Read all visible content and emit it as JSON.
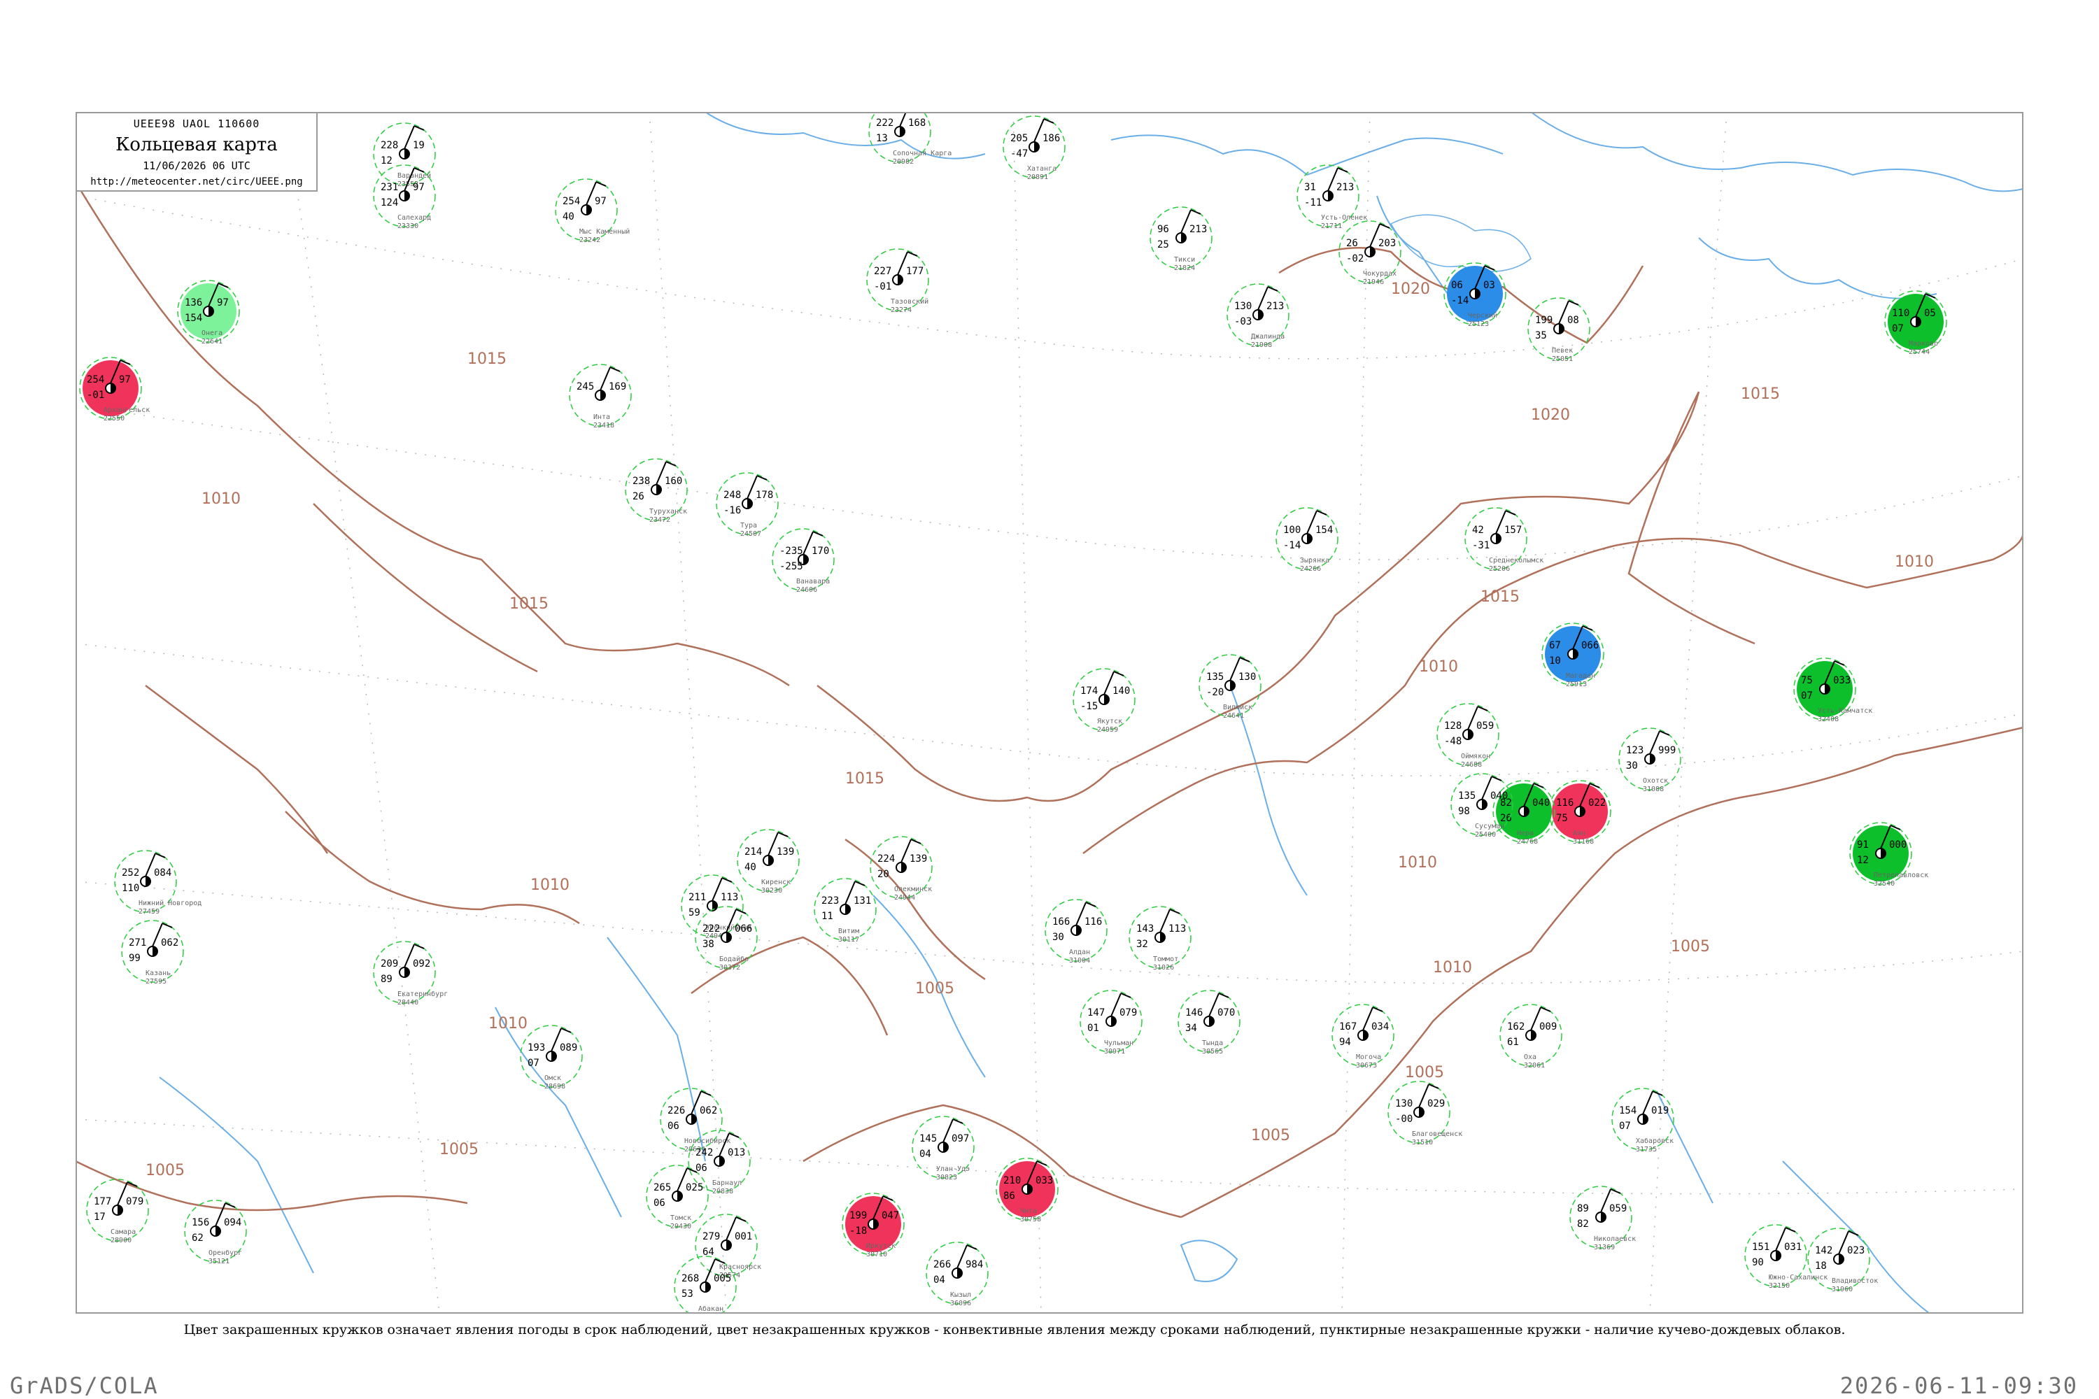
{
  "header": {
    "code_line": "UEEE98  UAOL  110600",
    "title": "Кольцевая карта",
    "datetime": "11/06/2026 06 UTC",
    "url": "http://meteocenter.net/circ/UEEE.png"
  },
  "caption": "Цвет закрашенных кружков означает явления погоды в срок наблюдений, цвет незакрашенных кружков - конвективные явления между сроками наблюдений, пунктирные незакрашенные кружки - наличие кучево-дождевых облаков.",
  "footer": {
    "left": "GrADS/COLA",
    "right": "2026-06-11-09:30"
  },
  "colors": {
    "isobar": "#b0705a",
    "water": "#6aaee8",
    "border": "#9a9a9a",
    "rain": "#0dbf2b",
    "thunder": "#f0335a",
    "snow": "#2b8de8",
    "drizzle": "#7ef29a",
    "cb_dashed": "#2ecc40"
  },
  "isobar_labels": [
    "1020",
    "1020",
    "1015",
    "1015",
    "1015",
    "1015",
    "1015",
    "1010",
    "1010",
    "1010",
    "1010",
    "1010",
    "1010",
    "1010",
    "1005",
    "1005",
    "1005",
    "1005",
    "1005",
    "1005"
  ],
  "stations": [
    {
      "name": "Варандей",
      "id": "23552",
      "p": "228",
      "t": "19",
      "td": "12",
      "color": "none"
    },
    {
      "name": "Салехард",
      "id": "23330",
      "p": "231",
      "t": "97",
      "td": "124",
      "color": "none"
    },
    {
      "name": "Мыс Каменный",
      "id": "23242",
      "p": "254",
      "t": "97",
      "td": "40",
      "color": "none"
    },
    {
      "name": "Тазовский",
      "id": "23274",
      "p": "227",
      "t": "177",
      "td": "-01",
      "color": "none"
    },
    {
      "name": "Сопочная Карга",
      "id": "20982",
      "p": "222",
      "t": "168",
      "td": "13",
      "color": "none"
    },
    {
      "name": "Хатанга",
      "id": "20891",
      "p": "205",
      "t": "186",
      "td": "-47",
      "color": "none"
    },
    {
      "name": "Усть-Оленек",
      "id": "21711",
      "p": "31",
      "t": "213",
      "td": "-11",
      "color": "none"
    },
    {
      "name": "Тикси",
      "id": "21824",
      "p": "96",
      "t": "213",
      "td": "25",
      "color": "none"
    },
    {
      "name": "Джалинда",
      "id": "21908",
      "p": "130",
      "t": "213",
      "td": "-03",
      "color": "none"
    },
    {
      "name": "Чокурдах",
      "id": "21946",
      "p": "26",
      "t": "203",
      "td": "-02",
      "color": "none"
    },
    {
      "name": "Черский",
      "id": "25123",
      "p": "06",
      "t": "03",
      "td": "-14",
      "color": "snow"
    },
    {
      "name": "Певек",
      "id": "25051",
      "p": "199",
      "t": "08",
      "td": "35",
      "color": "none"
    },
    {
      "name": "Марково",
      "id": "25744",
      "p": "110",
      "t": "05",
      "td": "07",
      "color": "rain"
    },
    {
      "name": "Архангельск",
      "id": "22550",
      "p": "254",
      "t": "97",
      "td": "-01",
      "color": "thunder"
    },
    {
      "name": "Онега",
      "id": "22641",
      "p": "136",
      "t": "97",
      "td": "154",
      "color": "drizzle"
    },
    {
      "name": "Инта",
      "id": "23418",
      "p": "245",
      "t": "169",
      "td": "",
      "color": "none"
    },
    {
      "name": "Туруханск",
      "id": "23472",
      "p": "238",
      "t": "160",
      "td": "26",
      "color": "none"
    },
    {
      "name": "Тура",
      "id": "24507",
      "p": "248",
      "t": "178",
      "td": "-16",
      "color": "none"
    },
    {
      "name": "Ванавара",
      "id": "24606",
      "p": "-235",
      "t": "170",
      "td": "-255",
      "color": "none"
    },
    {
      "name": "Вилюйск",
      "id": "24641",
      "p": "135",
      "t": "130",
      "td": "-20",
      "color": "none"
    },
    {
      "name": "Якутск",
      "id": "24959",
      "p": "174",
      "t": "140",
      "td": "-15",
      "color": "none"
    },
    {
      "name": "Оймякон",
      "id": "24688",
      "p": "128",
      "t": "059",
      "td": "-48",
      "color": "none"
    },
    {
      "name": "Зырянка",
      "id": "24266",
      "p": "100",
      "t": "154",
      "td": "-14",
      "color": "none"
    },
    {
      "name": "Среднеколымск",
      "id": "25206",
      "p": "42",
      "t": "157",
      "td": "-31",
      "color": "none"
    },
    {
      "name": "Магадан",
      "id": "25913",
      "p": "67",
      "t": "066",
      "td": "10",
      "color": "snow"
    },
    {
      "name": "Охотск",
      "id": "31088",
      "p": "123",
      "t": "999",
      "td": "30",
      "color": "none"
    },
    {
      "name": "Аян",
      "id": "31168",
      "p": "116",
      "t": "022",
      "td": "75",
      "color": "thunder"
    },
    {
      "name": "Усть-Камчатск",
      "id": "32408",
      "p": "75",
      "t": "033",
      "td": "07",
      "color": "rain"
    },
    {
      "name": "Петропавловск",
      "id": "32540",
      "p": "91",
      "t": "000",
      "td": "12",
      "color": "rain"
    },
    {
      "name": "Эвенкийская",
      "id": "24944",
      "p": "211",
      "t": "113",
      "td": "59",
      "color": "none"
    },
    {
      "name": "Киренск",
      "id": "30230",
      "p": "214",
      "t": "139",
      "td": "40",
      "color": "none"
    },
    {
      "name": "Бодайбо",
      "id": "30372",
      "p": "222",
      "t": "066",
      "td": "38",
      "color": "none"
    },
    {
      "name": "Витим",
      "id": "30117",
      "p": "223",
      "t": "131",
      "td": "11",
      "color": "none"
    },
    {
      "name": "Олекминск",
      "id": "24944",
      "p": "224",
      "t": "139",
      "td": "20",
      "color": "none"
    },
    {
      "name": "Алдан",
      "id": "31004",
      "p": "166",
      "t": "116",
      "td": "30",
      "color": "none"
    },
    {
      "name": "Томмот",
      "id": "31026",
      "p": "143",
      "t": "113",
      "td": "32",
      "color": "none"
    },
    {
      "name": "Нера",
      "id": "24768",
      "p": "82",
      "t": "040",
      "td": "26",
      "color": "rain"
    },
    {
      "name": "Сусуман",
      "id": "25400",
      "p": "135",
      "t": "040",
      "td": "98",
      "color": "none"
    },
    {
      "name": "Чульман",
      "id": "30971",
      "p": "147",
      "t": "079",
      "td": "01",
      "color": "none"
    },
    {
      "name": "Тында",
      "id": "30565",
      "p": "146",
      "t": "070",
      "td": "34",
      "color": "none"
    },
    {
      "name": "Могоча",
      "id": "30673",
      "p": "167",
      "t": "034",
      "td": "94",
      "color": "none"
    },
    {
      "name": "Чита",
      "id": "30758",
      "p": "210",
      "t": "033",
      "td": "86",
      "color": "thunder"
    },
    {
      "name": "Иркутск",
      "id": "30710",
      "p": "199",
      "t": "047",
      "td": "-18",
      "color": "thunder"
    },
    {
      "name": "Улан-Удэ",
      "id": "30823",
      "p": "145",
      "t": "097",
      "td": "04",
      "color": "none"
    },
    {
      "name": "Кызыл",
      "id": "36096",
      "p": "266",
      "t": "984",
      "td": "04",
      "color": "none"
    },
    {
      "name": "Благовещенск",
      "id": "31510",
      "p": "130",
      "t": "029",
      "td": "-00",
      "color": "none"
    },
    {
      "name": "Хабаровск",
      "id": "31735",
      "p": "154",
      "t": "019",
      "td": "07",
      "color": "none"
    },
    {
      "name": "Владивосток",
      "id": "31960",
      "p": "142",
      "t": "023",
      "td": "18",
      "color": "none"
    },
    {
      "name": "Николаевск",
      "id": "31369",
      "p": "89",
      "t": "059",
      "td": "82",
      "color": "none"
    },
    {
      "name": "Оха",
      "id": "32061",
      "p": "162",
      "t": "009",
      "td": "61",
      "color": "none"
    },
    {
      "name": "Южно-Сахалинск",
      "id": "32150",
      "p": "151",
      "t": "031",
      "td": "90",
      "color": "none"
    },
    {
      "name": "Нижний Новгород",
      "id": "27459",
      "p": "252",
      "t": "084",
      "td": "110",
      "color": "none"
    },
    {
      "name": "Казань",
      "id": "27595",
      "p": "271",
      "t": "062",
      "td": "99",
      "color": "none"
    },
    {
      "name": "Самара",
      "id": "28900",
      "p": "177",
      "t": "079",
      "td": "17",
      "color": "none"
    },
    {
      "name": "Оренбург",
      "id": "35121",
      "p": "156",
      "t": "094",
      "td": "62",
      "color": "none"
    },
    {
      "name": "Екатеринбург",
      "id": "28440",
      "p": "209",
      "t": "092",
      "td": "89",
      "color": "none"
    },
    {
      "name": "Омск",
      "id": "28698",
      "p": "193",
      "t": "089",
      "td": "07",
      "color": "none"
    },
    {
      "name": "Новосибирск",
      "id": "29634",
      "p": "226",
      "t": "062",
      "td": "06",
      "color": "none"
    },
    {
      "name": "Барнаул",
      "id": "29838",
      "p": "242",
      "t": "013",
      "td": "06",
      "color": "none"
    },
    {
      "name": "Томск",
      "id": "29430",
      "p": "265",
      "t": "025",
      "td": "06",
      "color": "none"
    },
    {
      "name": "Красноярск",
      "id": "29574",
      "p": "279",
      "t": "001",
      "td": "64",
      "color": "none"
    },
    {
      "name": "Абакан",
      "id": "29865",
      "p": "268",
      "t": "005",
      "td": "53",
      "color": "none"
    }
  ]
}
